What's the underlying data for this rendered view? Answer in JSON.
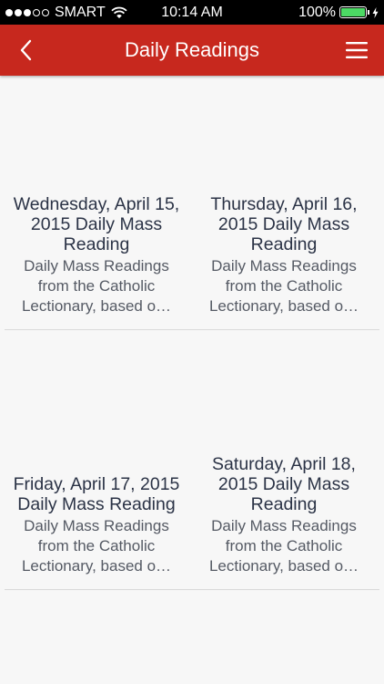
{
  "status_bar": {
    "carrier": "SMART",
    "time": "10:14 AM",
    "battery": "100%",
    "signal_bars_filled": 3,
    "signal_bars_total": 5
  },
  "nav": {
    "title": "Daily Readings",
    "back_icon": "chevron-left-icon",
    "menu_icon": "hamburger-menu-icon",
    "color": "#c7281e"
  },
  "readings": [
    {
      "title": "Wednesday, April 15, 2015 Daily Mass Reading",
      "description": "Daily Mass Readings from the Catholic Lectionary, based o…"
    },
    {
      "title": "Thursday, April 16, 2015 Daily Mass Reading",
      "description": "Daily Mass Readings from the Catholic Lectionary, based o…"
    },
    {
      "title": "Friday, April 17, 2015 Daily Mass Reading",
      "description": "Daily Mass Readings from the Catholic Lectionary, based o…"
    },
    {
      "title": "Saturday, April 18, 2015 Daily Mass Reading",
      "description": "Daily Mass Readings from the Catholic Lectionary, based o…"
    }
  ]
}
